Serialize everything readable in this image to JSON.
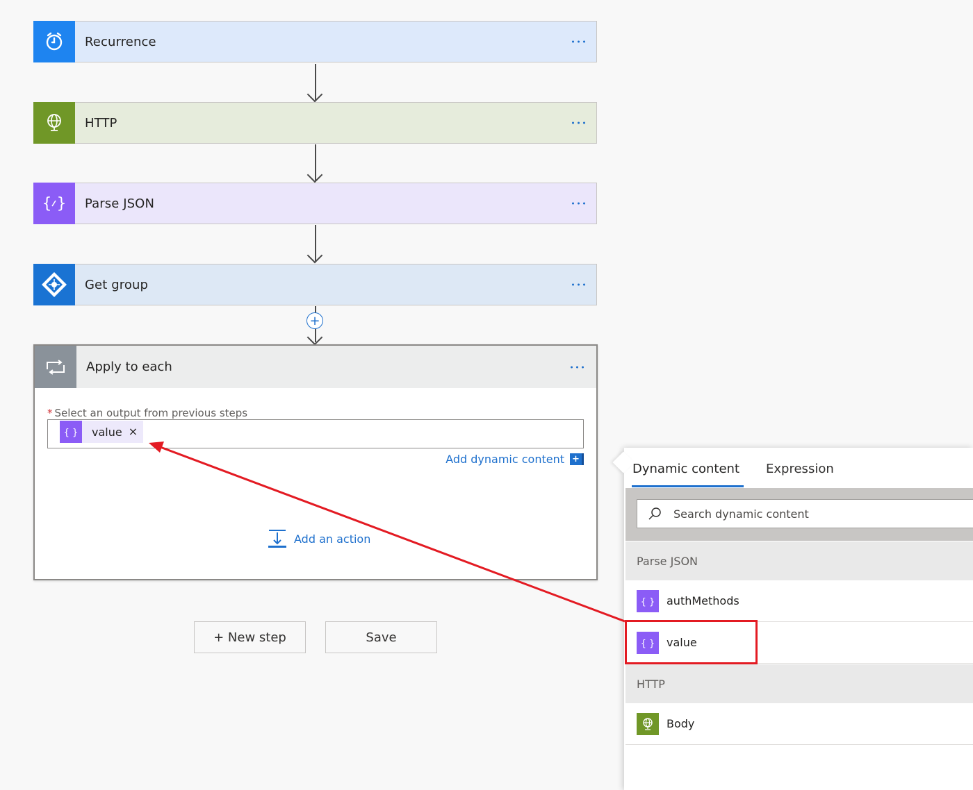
{
  "flow": {
    "steps": [
      {
        "id": "recurrence",
        "title": "Recurrence",
        "accent": "#1e84f0",
        "bg": "#dde9fb",
        "icon": "alarm-clock-icon"
      },
      {
        "id": "http",
        "title": "HTTP",
        "accent": "#709727",
        "bg": "#e6ecdc",
        "icon": "globe-icon"
      },
      {
        "id": "parse-json",
        "title": "Parse JSON",
        "accent": "#8b5cf6",
        "bg": "#ebe6fb",
        "icon": "json-braces-icon"
      },
      {
        "id": "get-group",
        "title": "Get group",
        "accent": "#1a73d3",
        "bg": "#dde8f5",
        "icon": "azure-ad-diamond-icon"
      }
    ],
    "loop": {
      "title": "Apply to each",
      "icon": "loop-arrows-icon",
      "field_label": "Select an output from previous steps",
      "required_mark": "*",
      "token": {
        "label": "value",
        "remove": "×",
        "icon": "json-braces-icon"
      },
      "add_dynamic": "Add dynamic content",
      "add_dynamic_icon": "+",
      "add_action": "Add an action"
    },
    "buttons": {
      "new_step": "+ New step",
      "save": "Save"
    },
    "insert_step": "+"
  },
  "panel": {
    "tabs": [
      {
        "label": "Dynamic content",
        "active": true
      },
      {
        "label": "Expression",
        "active": false
      }
    ],
    "search": {
      "placeholder": "Search dynamic content",
      "value": ""
    },
    "groups": [
      {
        "name": "Parse JSON",
        "items": [
          {
            "label": "authMethods",
            "icon": "json-braces-icon"
          },
          {
            "label": "value",
            "icon": "json-braces-icon",
            "highlighted": true
          }
        ]
      },
      {
        "name": "HTTP",
        "items": [
          {
            "label": "Body",
            "icon": "globe-icon"
          }
        ]
      }
    ]
  },
  "colors": {
    "link": "#1e70cd",
    "annotation": "#e31b23",
    "json_purple": "#8b5cf6",
    "http_green": "#709727"
  }
}
